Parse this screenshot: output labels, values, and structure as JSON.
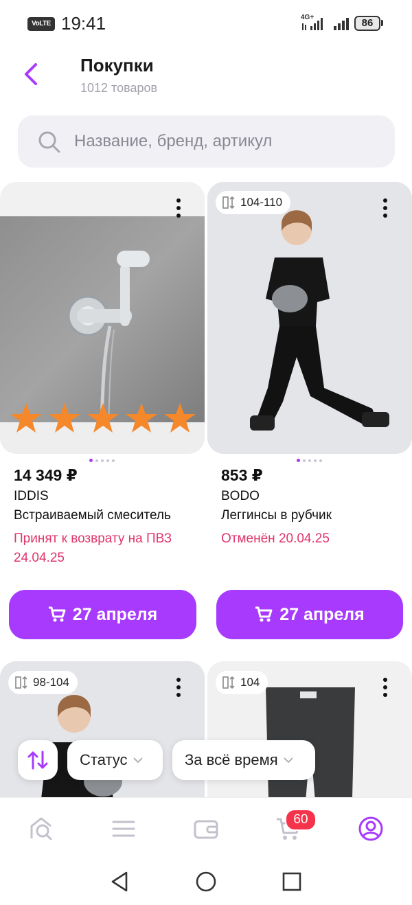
{
  "status_bar": {
    "volte": "VoLTE",
    "time": "19:41",
    "network": "4G+",
    "battery": "86"
  },
  "header": {
    "title": "Покупки",
    "subtitle": "1012 товаров"
  },
  "search": {
    "placeholder": "Название, бренд, артикул"
  },
  "products": [
    {
      "price": "14 349 ₽",
      "brand": "IDDIS",
      "name": "Встраиваемый смеситель",
      "status_line1": "Принят к возврату на ПВЗ",
      "status_line2": "24.04.25",
      "button_label": "27 апреля",
      "rating_stars": 5
    },
    {
      "size": "104-110",
      "price": "853 ₽",
      "brand": "BODO",
      "name": "Леггинсы в рубчик",
      "status_line1": "Отменён 20.04.25",
      "button_label": "27 апреля"
    },
    {
      "size": "98-104"
    },
    {
      "size": "104"
    }
  ],
  "filters": {
    "status_label": "Статус",
    "period_label": "За всё время"
  },
  "bottom_nav": {
    "cart_badge": "60"
  },
  "colors": {
    "accent": "#a73afd",
    "status_red": "#e0356b",
    "badge_red": "#f5334b"
  }
}
